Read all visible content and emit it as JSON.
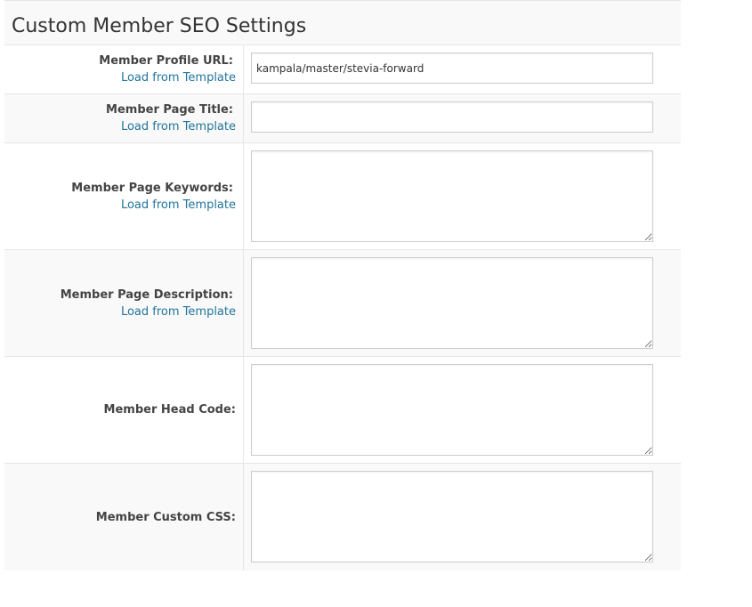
{
  "section": {
    "title": "Custom Member SEO Settings"
  },
  "fields": {
    "profile_url": {
      "label": "Member Profile URL:",
      "link": "Load from Template",
      "value": "kampala/master/stevia-forward"
    },
    "page_title": {
      "label": "Member Page Title:",
      "link": "Load from Template",
      "value": ""
    },
    "page_keywords": {
      "label": "Member Page Keywords:",
      "link": "Load from Template",
      "value": ""
    },
    "page_description": {
      "label": "Member Page Description:",
      "link": "Load from Template",
      "value": ""
    },
    "head_code": {
      "label": "Member Head Code:",
      "value": ""
    },
    "custom_css": {
      "label": "Member Custom CSS:",
      "value": ""
    }
  },
  "colors": {
    "link": "#21759b",
    "label": "#444444",
    "border": "#e6e6e6",
    "row_alt_background": "#f9f9f9"
  }
}
